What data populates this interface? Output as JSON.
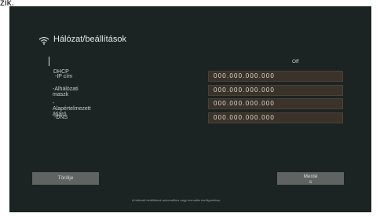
{
  "top_fragment": "zik.",
  "header": {
    "icon": "wifi-icon",
    "title": "Hálózat/beállítások"
  },
  "status": {
    "off": "Off"
  },
  "labels": {
    "dhcp": "DHCP",
    "ip": "-IP cím",
    "subnet": "-Alhálózati maszk",
    "gateway": "-Alapértelmezett átjáró",
    "dns": "-DNS"
  },
  "fields": {
    "ip": "000.000.000.000",
    "subnet": "000.000.000.000",
    "gateway": "000.000.000.000",
    "dns": "000.000.000.000"
  },
  "buttons": {
    "delete": "Törölje",
    "save": "Mentés"
  },
  "footer": {
    "note": "A hálózati beállítások automatikus vagy manuális konfigurálása."
  }
}
